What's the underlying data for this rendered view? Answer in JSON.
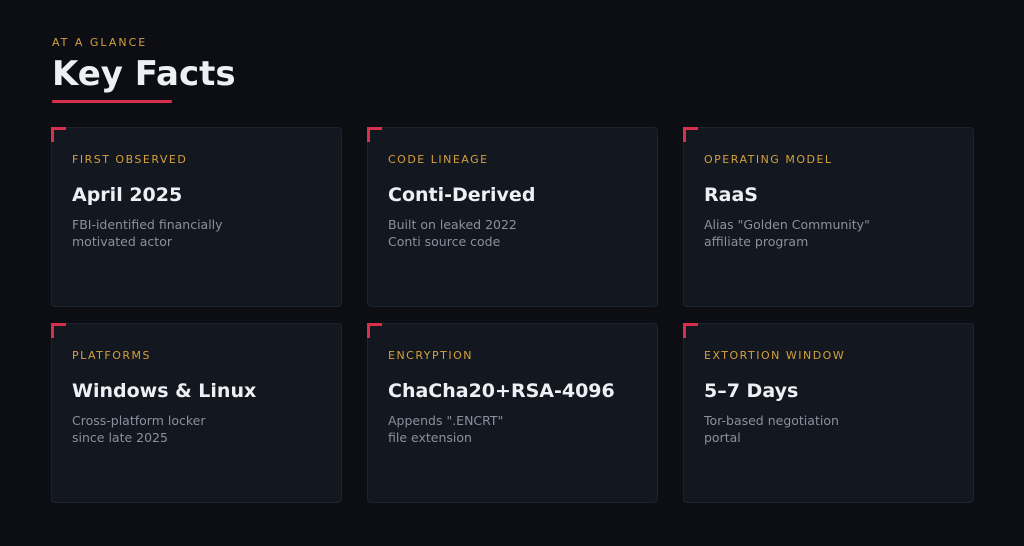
{
  "header": {
    "eyebrow": "AT A GLANCE",
    "title": "Key Facts"
  },
  "colors": {
    "background": "#0c0e14",
    "card": "#131720",
    "accent_red": "#d6304c",
    "accent_gold": "#d4a03c",
    "muted_text": "#8a909c"
  },
  "cards": [
    {
      "label": "FIRST OBSERVED",
      "value": "April 2025",
      "desc_line1": "FBI-identified financially",
      "desc_line2": "motivated actor"
    },
    {
      "label": "CODE LINEAGE",
      "value": "Conti-Derived",
      "desc_line1": "Built on leaked 2022",
      "desc_line2": "Conti source code"
    },
    {
      "label": "OPERATING MODEL",
      "value": "RaaS",
      "desc_line1": "Alias \"Golden Community\"",
      "desc_line2": "affiliate program"
    },
    {
      "label": "PLATFORMS",
      "value": "Windows & Linux",
      "desc_line1": "Cross-platform locker",
      "desc_line2": "since late 2025"
    },
    {
      "label": "ENCRYPTION",
      "value": "ChaCha20+RSA-4096",
      "desc_line1": "Appends \".ENCRT\"",
      "desc_line2": "file extension"
    },
    {
      "label": "EXTORTION WINDOW",
      "value": "5–7 Days",
      "desc_line1": "Tor-based negotiation",
      "desc_line2": "portal"
    }
  ]
}
